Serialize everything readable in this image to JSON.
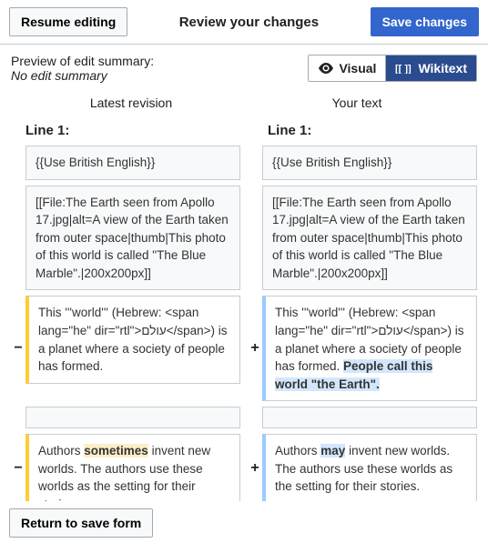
{
  "topbar": {
    "resume_label": "Resume editing",
    "title": "Review your changes",
    "save_label": "Save changes"
  },
  "summary": {
    "label": "Preview of edit summary:",
    "value": "No edit summary"
  },
  "toggle": {
    "visual": "Visual",
    "wikitext": "Wikitext"
  },
  "columns": {
    "left": "Latest revision",
    "right": "Your text"
  },
  "lines": {
    "left": "Line 1:",
    "right": "Line 1:"
  },
  "rows": [
    {
      "type": "context",
      "left": "{{Use British English}}",
      "right": "{{Use British English}}"
    },
    {
      "type": "context",
      "left": "[[File:The Earth seen from Apollo 17.jpg|alt=A view of the Earth taken from outer space|thumb|This photo of this world is called \"The Blue Marble\".|200x200px]]",
      "right": "[[File:The Earth seen from Apollo 17.jpg|alt=A view of the Earth taken from outer space|thumb|This photo of this world is called \"The Blue Marble\".|200x200px]]"
    },
    {
      "type": "change",
      "left": {
        "pre": "This '''world''' (Hebrew:  <span lang=\"he\" dir=\"rtl\">עולם</span>) is a planet where a society of people has formed.",
        "hl": "",
        "post": ""
      },
      "right": {
        "pre": "This '''world''' (Hebrew:  <span lang=\"he\" dir=\"rtl\">עולם</span>) is a planet where a society of people has formed. ",
        "hl": " People call this world \"the Earth\".",
        "post": ""
      }
    },
    {
      "type": "empty"
    },
    {
      "type": "change",
      "clip": true,
      "left": {
        "pre": "Authors ",
        "hl": "sometimes",
        "post": " invent new worlds. The authors use these worlds as the setting for their stories."
      },
      "right": {
        "pre": "Authors ",
        "hl": "may",
        "post": " invent new worlds. The authors use these worlds as the setting for their stories."
      }
    }
  ],
  "footer": {
    "return_label": "Return to save form"
  },
  "markers": {
    "minus": "−",
    "plus": "+"
  }
}
